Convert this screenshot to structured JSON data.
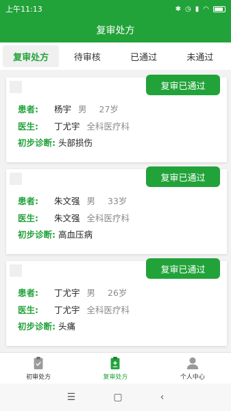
{
  "status_bar": {
    "time": "上午11:13",
    "icons": [
      "bluetooth-icon",
      "alarm-icon",
      "signal-icon",
      "wifi-icon",
      "battery-icon"
    ]
  },
  "header": {
    "title": "复审处方"
  },
  "tabs": [
    {
      "label": "复审处方",
      "active": true
    },
    {
      "label": "待审核",
      "active": false
    },
    {
      "label": "已通过",
      "active": false
    },
    {
      "label": "未通过",
      "active": false
    }
  ],
  "labels": {
    "patient": "患者:",
    "doctor": "医生:",
    "diagnosis": "初步诊断:"
  },
  "cards": [
    {
      "status": "复审已通过",
      "patient_name": "杨宇",
      "gender": "男",
      "age": "27岁",
      "doctor_name": "丁尤宇",
      "department": "全科医疗科",
      "diagnosis": "头部损伤"
    },
    {
      "status": "复审已通过",
      "patient_name": "朱文强",
      "gender": "男",
      "age": "33岁",
      "doctor_name": "朱文强",
      "department": "全科医疗科",
      "diagnosis": "高血压病"
    },
    {
      "status": "复审已通过",
      "patient_name": "丁尤宇",
      "gender": "男",
      "age": "26岁",
      "doctor_name": "丁尤宇",
      "department": "全科医疗科",
      "diagnosis": "头痛"
    }
  ],
  "bottom_nav": [
    {
      "label": "初审处方",
      "icon": "clipboard-check-icon",
      "active": false
    },
    {
      "label": "复审处方",
      "icon": "clipboard-plus-icon",
      "active": true
    },
    {
      "label": "个人中心",
      "icon": "user-icon",
      "active": false
    }
  ],
  "system_nav": {
    "menu": "☰",
    "home": "▢",
    "back": "‹"
  },
  "colors": {
    "primary": "#22a33a",
    "muted_text": "#8a8a8a"
  }
}
